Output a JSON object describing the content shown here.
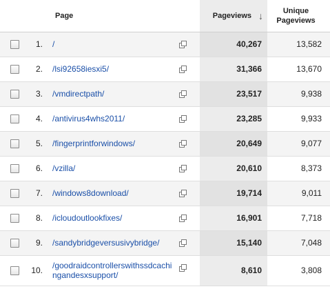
{
  "headers": {
    "page": "Page",
    "pageviews": "Pageviews",
    "unique_line1": "Unique",
    "unique_line2": "Pageviews"
  },
  "sort_icon": "arrow-down-icon",
  "rows": [
    {
      "num": "1.",
      "page": "/",
      "pageviews": "40,267",
      "unique": "13,582"
    },
    {
      "num": "2.",
      "page": "/lsi92658iesxi5/",
      "pageviews": "31,366",
      "unique": "13,670"
    },
    {
      "num": "3.",
      "page": "/vmdirectpath/",
      "pageviews": "23,517",
      "unique": "9,938"
    },
    {
      "num": "4.",
      "page": "/antivirus4whs2011/",
      "pageviews": "23,285",
      "unique": "9,933"
    },
    {
      "num": "5.",
      "page": "/fingerprintforwindows/",
      "pageviews": "20,649",
      "unique": "9,077"
    },
    {
      "num": "6.",
      "page": "/vzilla/",
      "pageviews": "20,610",
      "unique": "8,373"
    },
    {
      "num": "7.",
      "page": "/windows8download/",
      "pageviews": "19,714",
      "unique": "9,011"
    },
    {
      "num": "8.",
      "page": "/icloudoutlookfixes/",
      "pageviews": "16,901",
      "unique": "7,718"
    },
    {
      "num": "9.",
      "page": "/sandybridgeversusivybridge/",
      "pageviews": "15,140",
      "unique": "7,048"
    },
    {
      "num": "10.",
      "page": "/goodraidcontrollerswithssdcachingandesxsupport/",
      "page_line1": "/goodraidcontrollerswithssdcachi",
      "page_line2": "ngandesxsupport/",
      "pageviews": "8,610",
      "unique": "3,808"
    }
  ]
}
